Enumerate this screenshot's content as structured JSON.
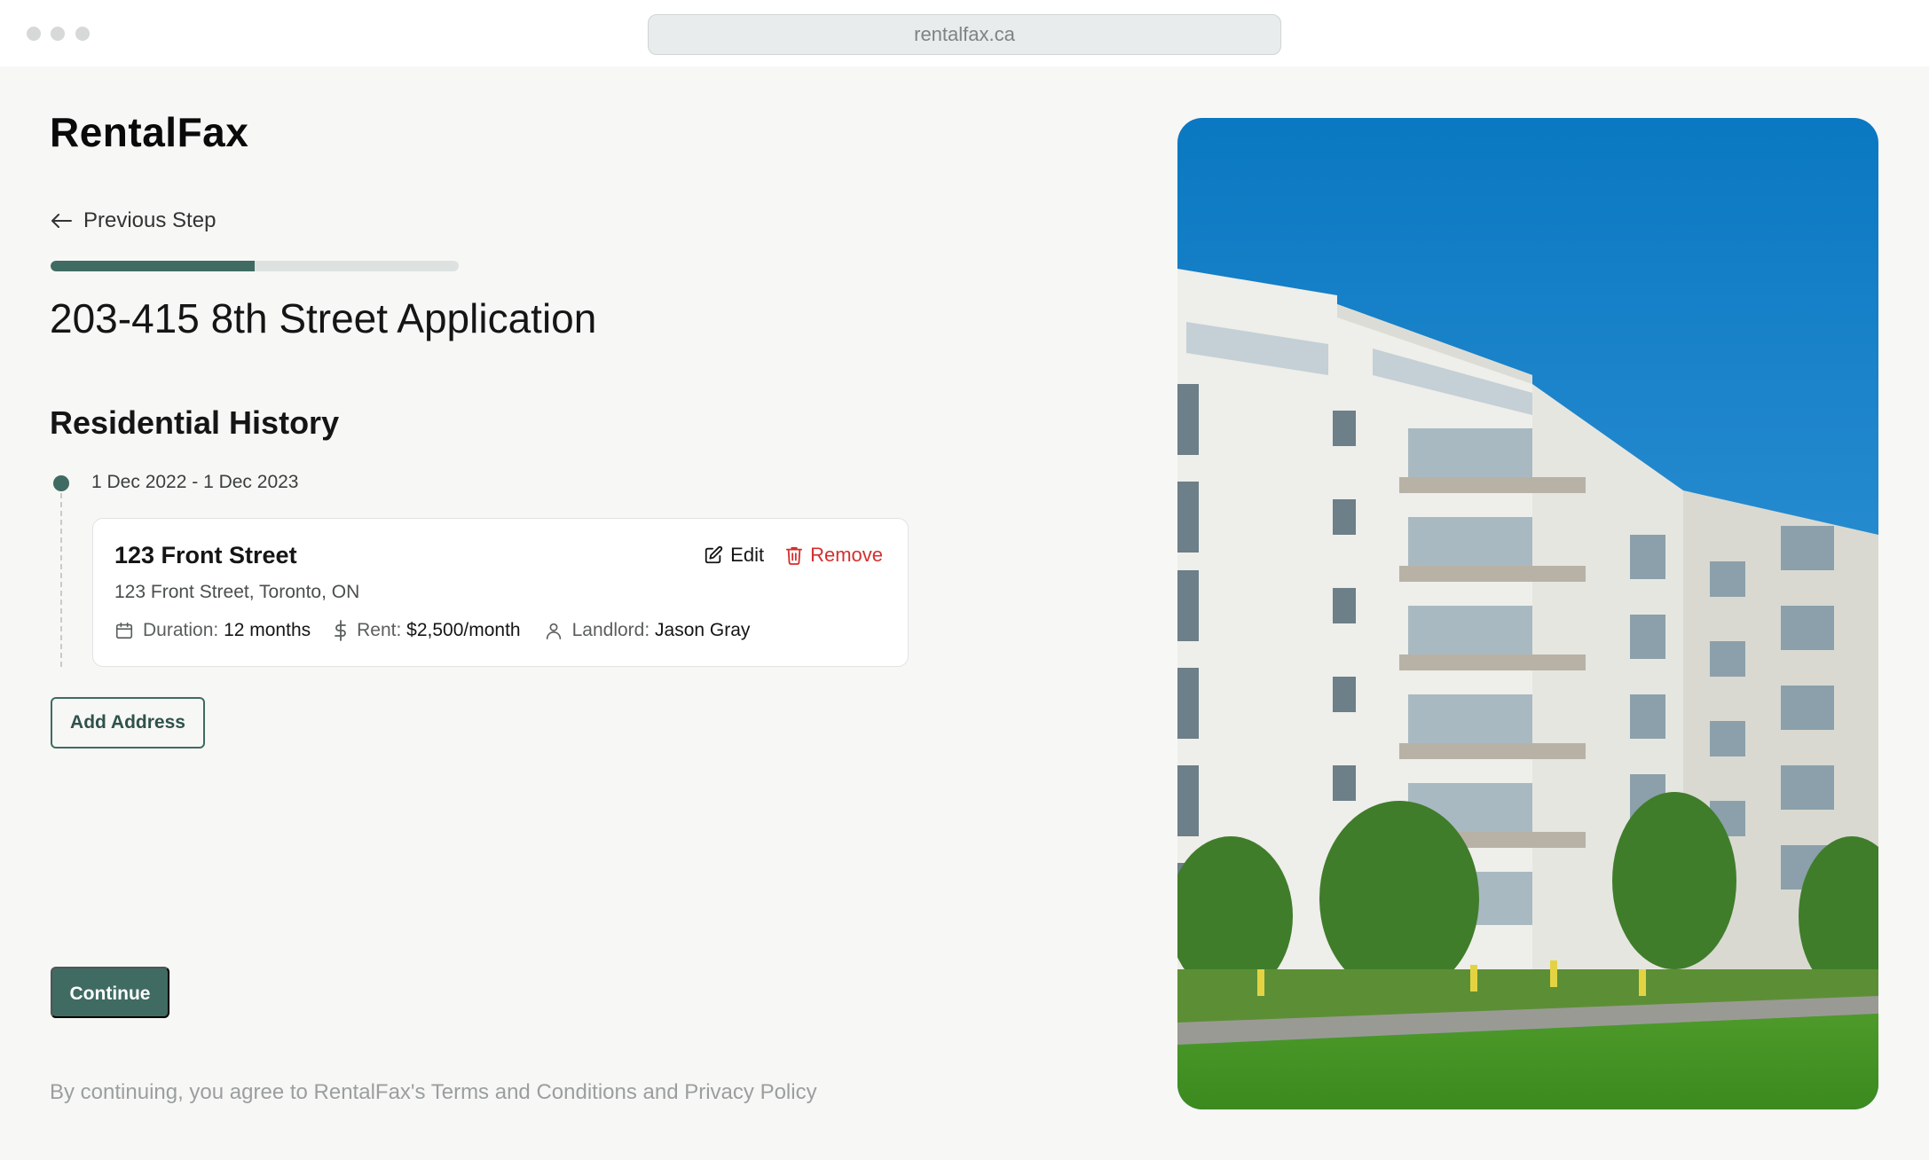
{
  "browser": {
    "url": "rentalfax.ca"
  },
  "brand": {
    "name": "RentalFax"
  },
  "nav": {
    "previous_label": "Previous Step",
    "previous_icon": "arrow-left-icon"
  },
  "progress": {
    "fraction": 0.5
  },
  "page": {
    "title": "203-415 8th Street Application"
  },
  "section": {
    "title": "Residential History"
  },
  "history": [
    {
      "date_range": "1 Dec 2022 - 1 Dec 2023",
      "name": "123 Front Street",
      "address": "123 Front Street, Toronto, ON",
      "edit_label": "Edit",
      "remove_label": "Remove",
      "duration_label": "Duration:",
      "duration_value": "12 months",
      "rent_label": "Rent:",
      "rent_value": "$2,500/month",
      "landlord_label": "Landlord:",
      "landlord_value": "Jason Gray"
    }
  ],
  "actions": {
    "add_address": "Add Address",
    "continue": "Continue"
  },
  "footer": {
    "terms": "By continuing, you agree to RentalFax's Terms and Conditions and Privacy Policy"
  },
  "colors": {
    "accent": "#3f6b62",
    "danger": "#d32f2f",
    "muted": "#9a9f9e"
  }
}
